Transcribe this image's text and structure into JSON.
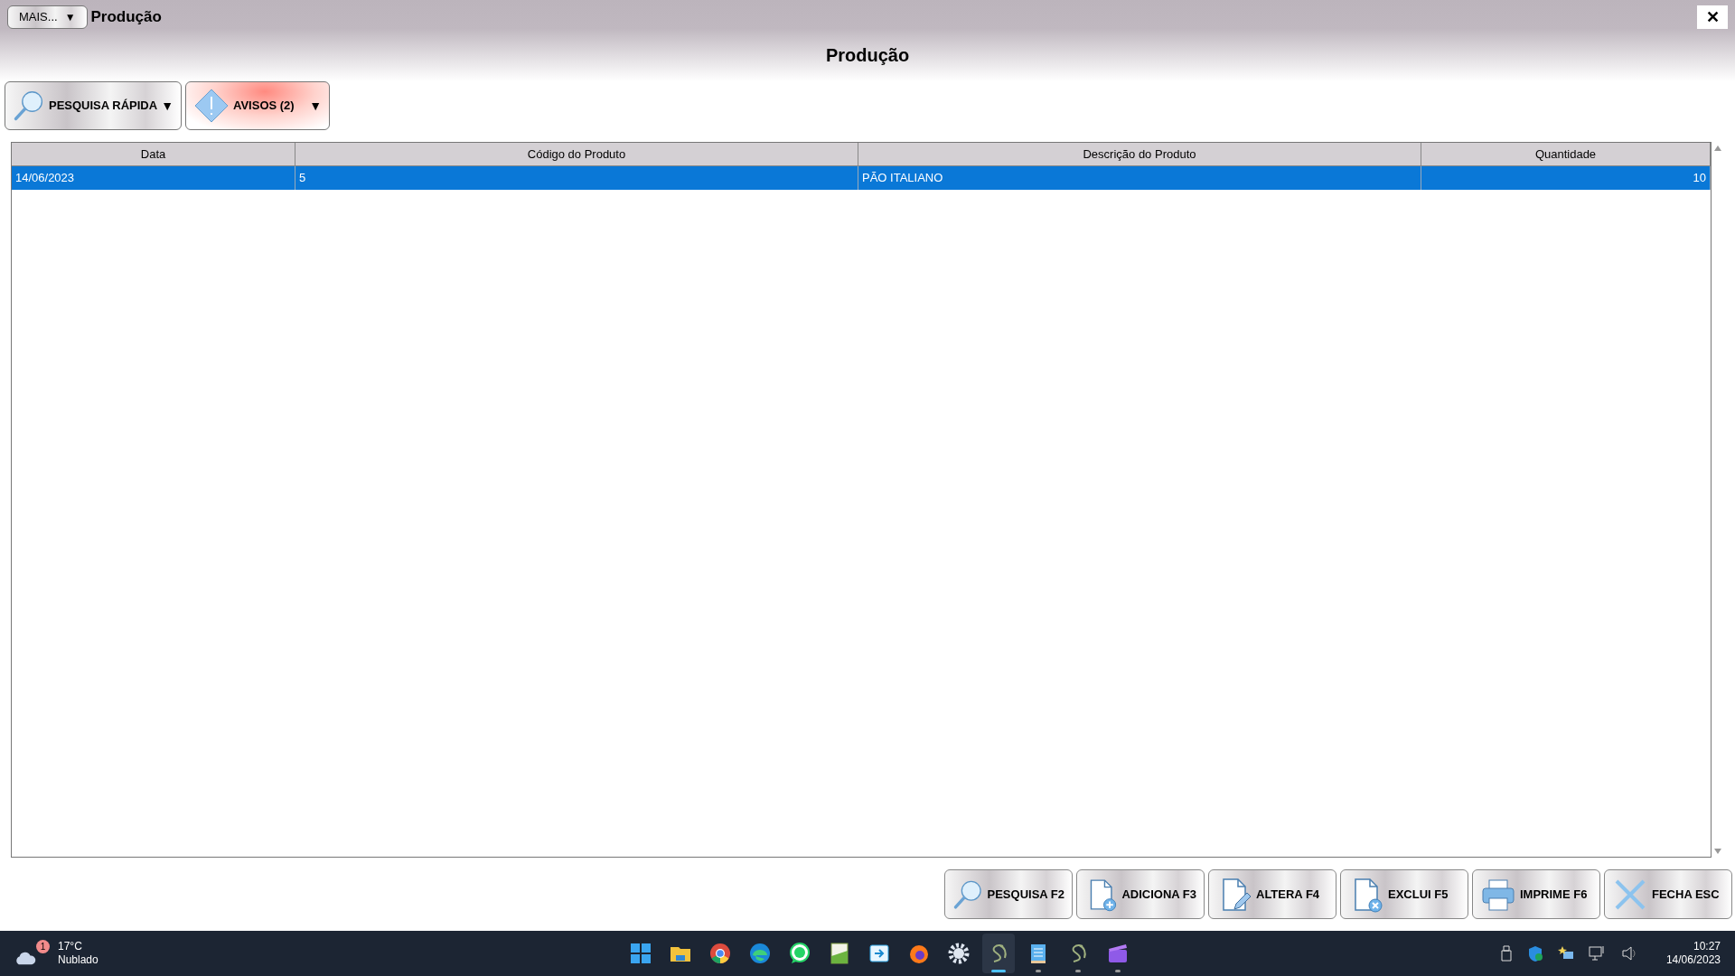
{
  "window": {
    "menu_button": "MAIS...",
    "menu_caret": "▼",
    "title": "Produção",
    "close": "✕",
    "heading": "Produção"
  },
  "toolbar": [
    {
      "kind": "search",
      "label": "PESQUISA RÁPIDA",
      "caret": "▼"
    },
    {
      "kind": "warning",
      "label": "AVISOS (2)",
      "caret": "▼"
    }
  ],
  "table": {
    "columns": [
      "Data",
      "Código do Produto",
      "Descrição do Produto",
      "Quantidade"
    ],
    "rows": [
      {
        "selected": true,
        "cells": [
          "14/06/2023",
          "5",
          "PÃO ITALIANO",
          "10"
        ]
      }
    ]
  },
  "actions": [
    {
      "kind": "search",
      "label": "PESQUISA F2"
    },
    {
      "kind": "add",
      "label": "ADICIONA F3"
    },
    {
      "kind": "edit",
      "label": "ALTERA F4"
    },
    {
      "kind": "delete",
      "label": "EXCLUI F5"
    },
    {
      "kind": "print",
      "label": "IMPRIME F6"
    },
    {
      "kind": "close",
      "label": "FECHA ESC"
    }
  ],
  "taskbar": {
    "weather": {
      "badge": "1",
      "temperature": "17°C",
      "condition": "Nublado"
    },
    "apps": [
      {
        "kind": "start",
        "running": false,
        "selected": false
      },
      {
        "kind": "folder",
        "running": false,
        "selected": false
      },
      {
        "kind": "chrome",
        "running": false,
        "selected": false
      },
      {
        "kind": "edge",
        "running": false,
        "selected": false
      },
      {
        "kind": "whatsapp",
        "running": false,
        "selected": false
      },
      {
        "kind": "sheet",
        "running": false,
        "selected": false
      },
      {
        "kind": "share",
        "running": false,
        "selected": false
      },
      {
        "kind": "firefox",
        "running": false,
        "selected": false
      },
      {
        "kind": "gear",
        "running": false,
        "selected": false
      },
      {
        "kind": "swirl",
        "running": true,
        "selected": true
      },
      {
        "kind": "notepad",
        "running": true,
        "selected": false
      },
      {
        "kind": "swirl",
        "running": true,
        "selected": false
      },
      {
        "kind": "clapper",
        "running": true,
        "selected": false
      }
    ],
    "time": "10:27",
    "date": "14/06/2023"
  }
}
